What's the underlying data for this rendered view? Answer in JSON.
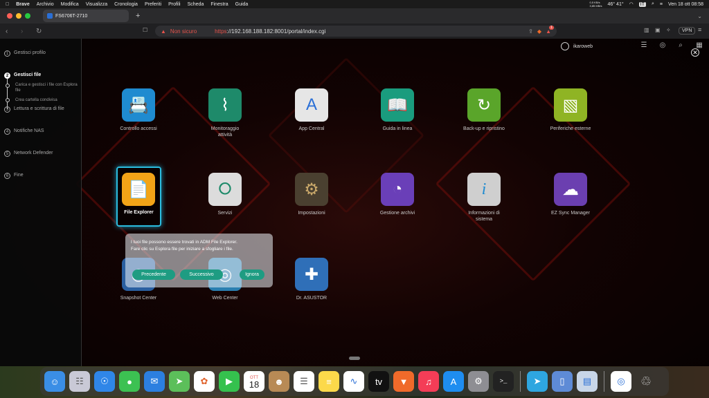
{
  "menubar": {
    "app": "Brave",
    "items": [
      "Archivio",
      "Modifica",
      "Visualizza",
      "Cronologia",
      "Preferiti",
      "Profili",
      "Scheda",
      "Finestra",
      "Guida"
    ],
    "temps": "46° 41°",
    "lang": "IT",
    "datetime": "Ven 18 ott  08:58",
    "net_up": "0,5 KB/s",
    "net_down": "3,85 MB/s"
  },
  "browser": {
    "tab_title": "FS6706T-2710",
    "new_tab": "+",
    "insecure_label": "Non sicuro",
    "url_scheme": "https",
    "url_rest": "://192.168.188.182:8001/portal/index.cgi",
    "vpn_label": "VPN",
    "shield_badge": "1"
  },
  "sidebar": {
    "steps": [
      {
        "num": "1",
        "label": "Gestisci profilo"
      },
      {
        "num": "2",
        "label": "Gestisci file"
      },
      {
        "num": "3",
        "label": "Lettura e scrittura di file"
      },
      {
        "num": "4",
        "label": "Notifiche NAS"
      },
      {
        "num": "5",
        "label": "Network Defender"
      },
      {
        "num": "6",
        "label": "Fine"
      }
    ],
    "substeps": [
      "Carica e gestisci i file con Esplora file",
      "Crea cartella condivisa"
    ]
  },
  "header": {
    "username": "ikaroweb"
  },
  "apps": [
    {
      "label": "Controllo accessi",
      "icon": "id-card-icon",
      "color": "#1f8bd0"
    },
    {
      "label": "Monitoraggio attività",
      "icon": "heartbeat-icon",
      "color": "#1e8a6a"
    },
    {
      "label": "App Central",
      "icon": "app-central-icon",
      "color": "#e6e6e6"
    },
    {
      "label": "Guida in linea",
      "icon": "book-icon",
      "color": "#1a9c7e"
    },
    {
      "label": "Back-up e ripristino",
      "icon": "restore-icon",
      "color": "#5aa52a"
    },
    {
      "label": "Periferiche esterne",
      "icon": "usb-icon",
      "color": "#8fb424"
    },
    {
      "label": "File Explorer",
      "icon": "file-icon",
      "color": "#f2a417"
    },
    {
      "label": "Servizi",
      "icon": "services-icon",
      "color": "#dcdcdc"
    },
    {
      "label": "Impostazioni",
      "icon": "gear-icon",
      "color": "#4a4030"
    },
    {
      "label": "Gestione archivi",
      "icon": "storage-icon",
      "color": "#6a3fb8"
    },
    {
      "label": "Informazioni di sistema",
      "icon": "info-icon",
      "color": "#cfcfcf"
    },
    {
      "label": "EZ Sync Manager",
      "icon": "cloud-sync-icon",
      "color": "#6b3fb0"
    },
    {
      "label": "Snapshot Center",
      "icon": "snapshot-icon",
      "color": "#2a5fa0"
    },
    {
      "label": "Web Center",
      "icon": "web-icon",
      "color": "#2a7fb0"
    },
    {
      "label": "Dr. ASUSTOR",
      "icon": "doctor-icon",
      "color": "#2f6fb8"
    }
  ],
  "tooltip": {
    "line1": "I tuoi file possono essere trovati in ADM File Explorer.",
    "line2": "Fare clic su Esplora file per iniziare a sfogliare i file.",
    "prev": "Precedente",
    "next": "Successivo",
    "ignore": "Ignora"
  },
  "dock": {
    "calendar_month": "OTT",
    "calendar_day": "18",
    "apps": [
      "finder-icon",
      "launchpad-icon",
      "safari-icon",
      "messages-icon",
      "mail-icon",
      "maps-icon",
      "photos-icon",
      "facetime-icon",
      "calendar-icon",
      "contacts-icon",
      "reminders-icon",
      "notes-icon",
      "freeform-icon",
      "appletv-icon",
      "brave-icon",
      "music-icon",
      "appstore-icon",
      "settings-icon",
      "terminal-icon",
      "telegram-icon",
      "iphone-mirroring-icon",
      "finder-window-icon",
      "preview-icon",
      "trash-icon"
    ]
  }
}
